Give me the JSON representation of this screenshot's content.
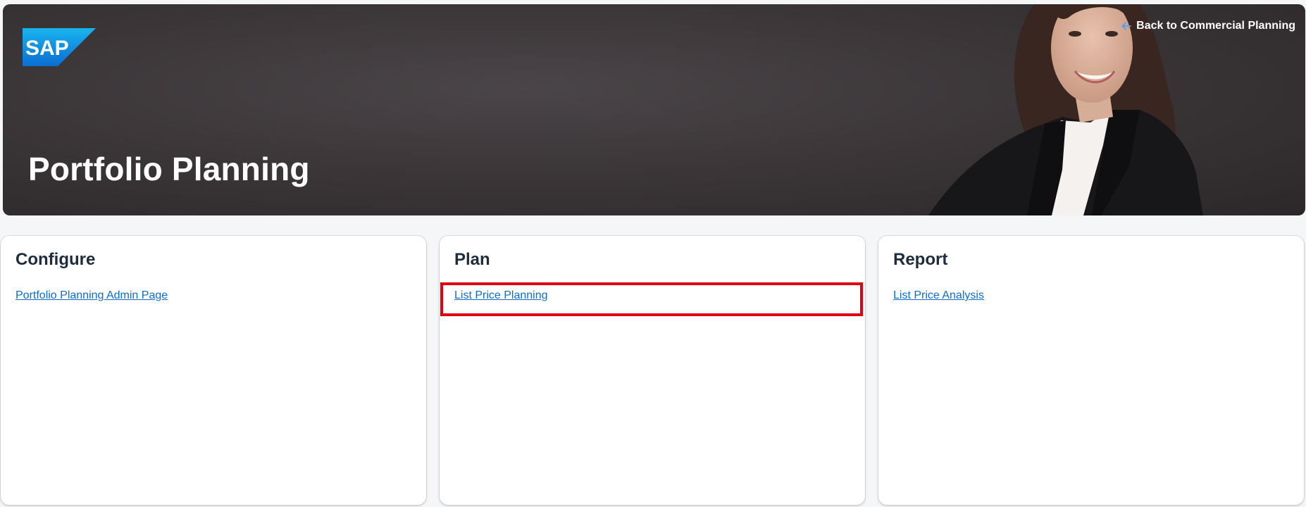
{
  "header": {
    "logo_text": "SAP",
    "title": "Portfolio Planning",
    "back_link": "Back to Commercial Planning",
    "back_icon": "arrow-left-icon",
    "colors": {
      "logo_blue": "#0a6ed1",
      "link_blue": "#0a6ed1",
      "highlight_red": "#e0000f"
    }
  },
  "cards": [
    {
      "title": "Configure",
      "link": "Portfolio Planning Admin Page"
    },
    {
      "title": "Plan",
      "link": "List Price Planning",
      "highlighted": true
    },
    {
      "title": "Report",
      "link": "List Price Analysis"
    }
  ]
}
